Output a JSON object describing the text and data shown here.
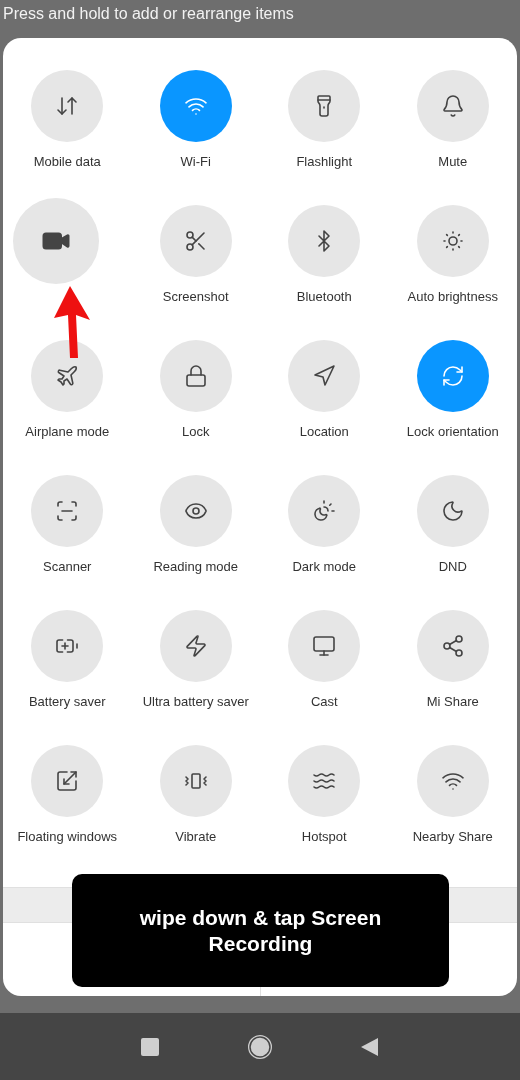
{
  "hint": "Press and hold to add or rearrange items",
  "tiles": [
    {
      "kind": "toggle",
      "label": "Mobile data",
      "on": false
    },
    {
      "kind": "toggle",
      "label": "Wi-Fi",
      "on": true
    },
    {
      "kind": "toggle",
      "label": "Flashlight",
      "on": false
    },
    {
      "kind": "toggle",
      "label": "Mute",
      "on": false
    },
    {
      "kind": "dragged",
      "on": false
    },
    {
      "kind": "toggle",
      "label": "Screenshot",
      "on": false
    },
    {
      "kind": "toggle",
      "label": "Bluetooth",
      "on": false
    },
    {
      "kind": "toggle",
      "label": "Auto brightness",
      "on": false
    },
    {
      "kind": "toggle",
      "label": "Airplane mode",
      "on": false
    },
    {
      "kind": "toggle",
      "label": "Lock",
      "on": false
    },
    {
      "kind": "toggle",
      "label": "Location",
      "on": false
    },
    {
      "kind": "toggle",
      "label": "Lock orientation",
      "on": true
    },
    {
      "kind": "toggle",
      "label": "Scanner",
      "on": false
    },
    {
      "kind": "toggle",
      "label": "Reading mode",
      "on": false
    },
    {
      "kind": "toggle",
      "label": "Dark mode",
      "on": false
    },
    {
      "kind": "toggle",
      "label": "DND",
      "on": false
    },
    {
      "kind": "toggle",
      "label": "Battery saver",
      "on": false
    },
    {
      "kind": "toggle",
      "label": "Ultra battery saver",
      "on": false
    },
    {
      "kind": "toggle",
      "label": "Cast",
      "on": false
    },
    {
      "kind": "toggle",
      "label": "Mi Share",
      "on": false
    },
    {
      "kind": "toggle",
      "label": "Floating windows",
      "on": false
    },
    {
      "kind": "toggle",
      "label": "Vibrate",
      "on": false
    },
    {
      "kind": "toggle",
      "label": "Hotspot",
      "on": false
    },
    {
      "kind": "toggle",
      "label": "Nearby Share",
      "on": false
    }
  ],
  "caption": "wipe down & tap Screen Recording"
}
